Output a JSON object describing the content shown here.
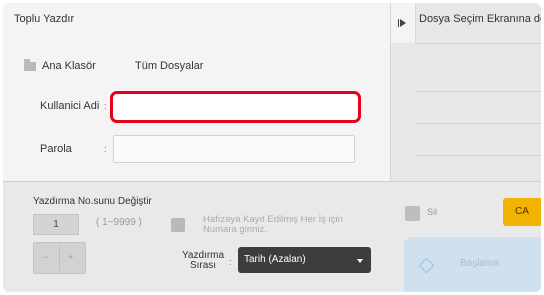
{
  "app": {
    "title": "Toplu Yazdır"
  },
  "right_panel": {
    "title": "Dosya Seçim Ekranına dön",
    "toggle_icon": "expand-arrow-icon"
  },
  "breadcrumb": {
    "root_icon": "folder-icon",
    "root_label": "Ana Klasör",
    "current_label": "Tüm Dosyalar"
  },
  "form": {
    "username": {
      "label": "Kullanici Adi",
      "colon": ":",
      "value": "",
      "placeholder": ""
    },
    "password": {
      "label": "Parola",
      "colon": ":",
      "value": "",
      "placeholder": ""
    }
  },
  "print_number": {
    "title": "Yazdırma No.sunu Değiştir",
    "value": "1",
    "range": "( 1~9999 )",
    "stepper_down": "−",
    "stepper_up": "+"
  },
  "memory_option": {
    "label_line1": "Hafızaya Kayıt Edilmiş Her İş için",
    "label_line2": "Numara giriniz."
  },
  "sort": {
    "label_line1": "Yazdırma",
    "label_line2": "Sırası",
    "colon": ":",
    "selected": "Tarih (Azalan)"
  },
  "actions": {
    "delete_label": "Sil",
    "clear_label": "CA",
    "start_label": "Başlama"
  },
  "colors": {
    "focus": "#e5001d",
    "ca": "#f2b200",
    "start": "#cfe0ee",
    "select": "#3d3d3d"
  }
}
